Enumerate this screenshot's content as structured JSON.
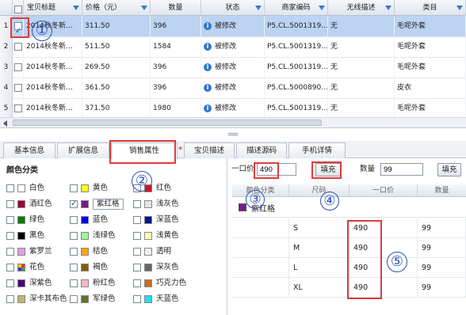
{
  "grid": {
    "headers": {
      "title": "宝贝标题",
      "price": "价格（元）",
      "qty": "数量",
      "status": "状态",
      "code": "商家编码",
      "wireless": "无线描述",
      "category": "类目"
    },
    "rows": [
      {
        "num": "1",
        "checked": true,
        "title": "2014秋冬新…",
        "price": "311.50",
        "qty": "396",
        "status": "被修改",
        "code": "P5.CL.5001319…",
        "wireless": "无",
        "category": "毛呢外套"
      },
      {
        "num": "2",
        "checked": false,
        "title": "2014秋冬新…",
        "price": "511.50",
        "qty": "1584",
        "status": "被修改",
        "code": "P5.CL.5001319…",
        "wireless": "无",
        "category": "毛呢外套"
      },
      {
        "num": "3",
        "checked": false,
        "title": "2014秋冬新…",
        "price": "269.50",
        "qty": "396",
        "status": "被修改",
        "code": "P5.CL.5001319…",
        "wireless": "无",
        "category": "毛呢外套"
      },
      {
        "num": "4",
        "checked": false,
        "title": "2014秋冬新…",
        "price": "361.50",
        "qty": "396",
        "status": "被修改",
        "code": "P5.CL.5000890…",
        "wireless": "无",
        "category": "皮衣"
      },
      {
        "num": "5",
        "checked": false,
        "title": "2014秋冬新…",
        "price": "371.50",
        "qty": "1980",
        "status": "被修改",
        "code": "P5.CL.5001319…",
        "wireless": "无",
        "category": "毛呢外套"
      }
    ]
  },
  "tabs": [
    "基本信息",
    "扩展信息",
    "销售属性",
    "宝贝描述",
    "描述源码",
    "手机详情"
  ],
  "tab_required_mark": "*",
  "color_panel": {
    "title": "颜色分类",
    "items": [
      {
        "label": "白色",
        "color": "#ffffff",
        "checked": false
      },
      {
        "label": "黄色",
        "color": "#ffff00",
        "checked": false
      },
      {
        "label": "红色",
        "color": "#ff0000",
        "checked": false
      },
      {
        "label": "酒红色",
        "color": "#990033",
        "checked": false
      },
      {
        "label": "紫红格",
        "color": "#7a1a8c",
        "checked": true
      },
      {
        "label": "浅灰色",
        "color": "#e4e4e4",
        "checked": false
      },
      {
        "label": "绿色",
        "color": "#008000",
        "checked": false
      },
      {
        "label": "蓝色",
        "color": "#0000ff",
        "checked": false
      },
      {
        "label": "深蓝色",
        "color": "#041690",
        "checked": false
      },
      {
        "label": "黑色",
        "color": "#000000",
        "checked": false
      },
      {
        "label": "浅绿色",
        "color": "#98fb98",
        "checked": false
      },
      {
        "label": "浅黄色",
        "color": "#ffffb1",
        "checked": false
      },
      {
        "label": "紫罗兰",
        "color": "#dda0dd",
        "checked": false
      },
      {
        "label": "桔色",
        "color": "#ffa500",
        "checked": false
      },
      {
        "label": "透明",
        "color": "#f2f2f2",
        "checked": false
      },
      {
        "label": "花色",
        "color": "#e06030",
        "checked": false
      },
      {
        "label": "褐色",
        "color": "#855b00",
        "checked": false
      },
      {
        "label": "深灰色",
        "color": "#666666",
        "checked": false
      },
      {
        "label": "深紫色",
        "color": "#4b0082",
        "checked": false
      },
      {
        "label": "粉红色",
        "color": "#ffb6c1",
        "checked": false
      },
      {
        "label": "巧克力色",
        "color": "#d2691e",
        "checked": false
      },
      {
        "label": "深卡其布色",
        "color": "#bdb76b",
        "checked": false
      },
      {
        "label": "军绿色",
        "color": "#5d762a",
        "checked": false
      },
      {
        "label": "天蓝色",
        "color": "#1eddff",
        "checked": false
      }
    ]
  },
  "price_panel": {
    "price_label": "一口价",
    "price_value": "490",
    "fill_label": "填充",
    "qty_label": "数量",
    "qty_value": "99",
    "fill_label_2": "填充",
    "table_headers": [
      "颜色分类",
      "尺码",
      "一口价",
      "数量"
    ],
    "group_name": "紫红格",
    "group_color": "#7a1a8c",
    "rows": [
      {
        "size": "S",
        "price": "490",
        "qty": "99"
      },
      {
        "size": "M",
        "price": "490",
        "qty": "99"
      },
      {
        "size": "L",
        "price": "490",
        "qty": "99"
      },
      {
        "size": "XL",
        "price": "490",
        "qty": "99"
      }
    ]
  },
  "annotations": [
    "①",
    "②",
    "③",
    "④",
    "⑤"
  ]
}
